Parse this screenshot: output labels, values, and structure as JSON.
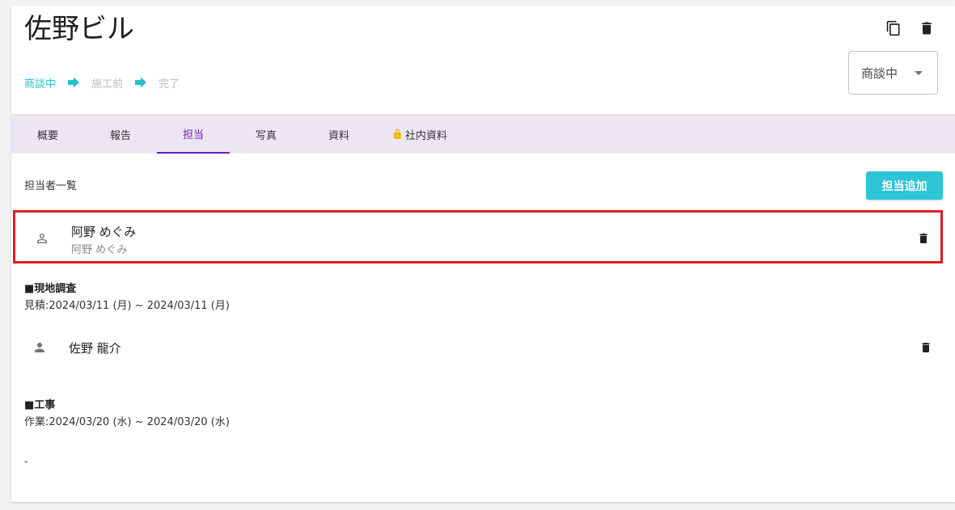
{
  "header": {
    "title": "佐野ビル",
    "copy_icon": "copy-icon",
    "delete_icon": "trash-icon"
  },
  "steps": [
    {
      "label": "商談中",
      "active": true
    },
    {
      "label": "施工前",
      "active": false
    },
    {
      "label": "完了",
      "active": false
    }
  ],
  "status_select": {
    "value": "商談中"
  },
  "tabs": [
    {
      "label": "概要"
    },
    {
      "label": "報告"
    },
    {
      "label": "担当"
    },
    {
      "label": "写真"
    },
    {
      "label": "資料"
    },
    {
      "label": "社内資料",
      "icon": "lock-icon"
    }
  ],
  "active_tab": "担当",
  "assignees": {
    "section_title": "担当者一覧",
    "add_label": "担当追加",
    "members": [
      {
        "name": "阿野 めぐみ",
        "sub": "阿野 めぐみ",
        "icon": "person-outline-icon",
        "task_title": "■現地調査",
        "task_date": "見積:2024/03/11 (月) ~ 2024/03/11 (月)"
      },
      {
        "name": "佐野 龍介",
        "icon": "person-icon",
        "task_title": "■工事",
        "task_date": "作業:2024/03/20 (水) ~ 2024/03/20 (水)"
      }
    ]
  },
  "footer_text": "-",
  "colors": {
    "accent": "#2ec5d6",
    "tab_active": "#6a1fb0",
    "tab_bg": "#ece6f3",
    "highlight": "#e01d26",
    "lock": "#f5b400"
  }
}
